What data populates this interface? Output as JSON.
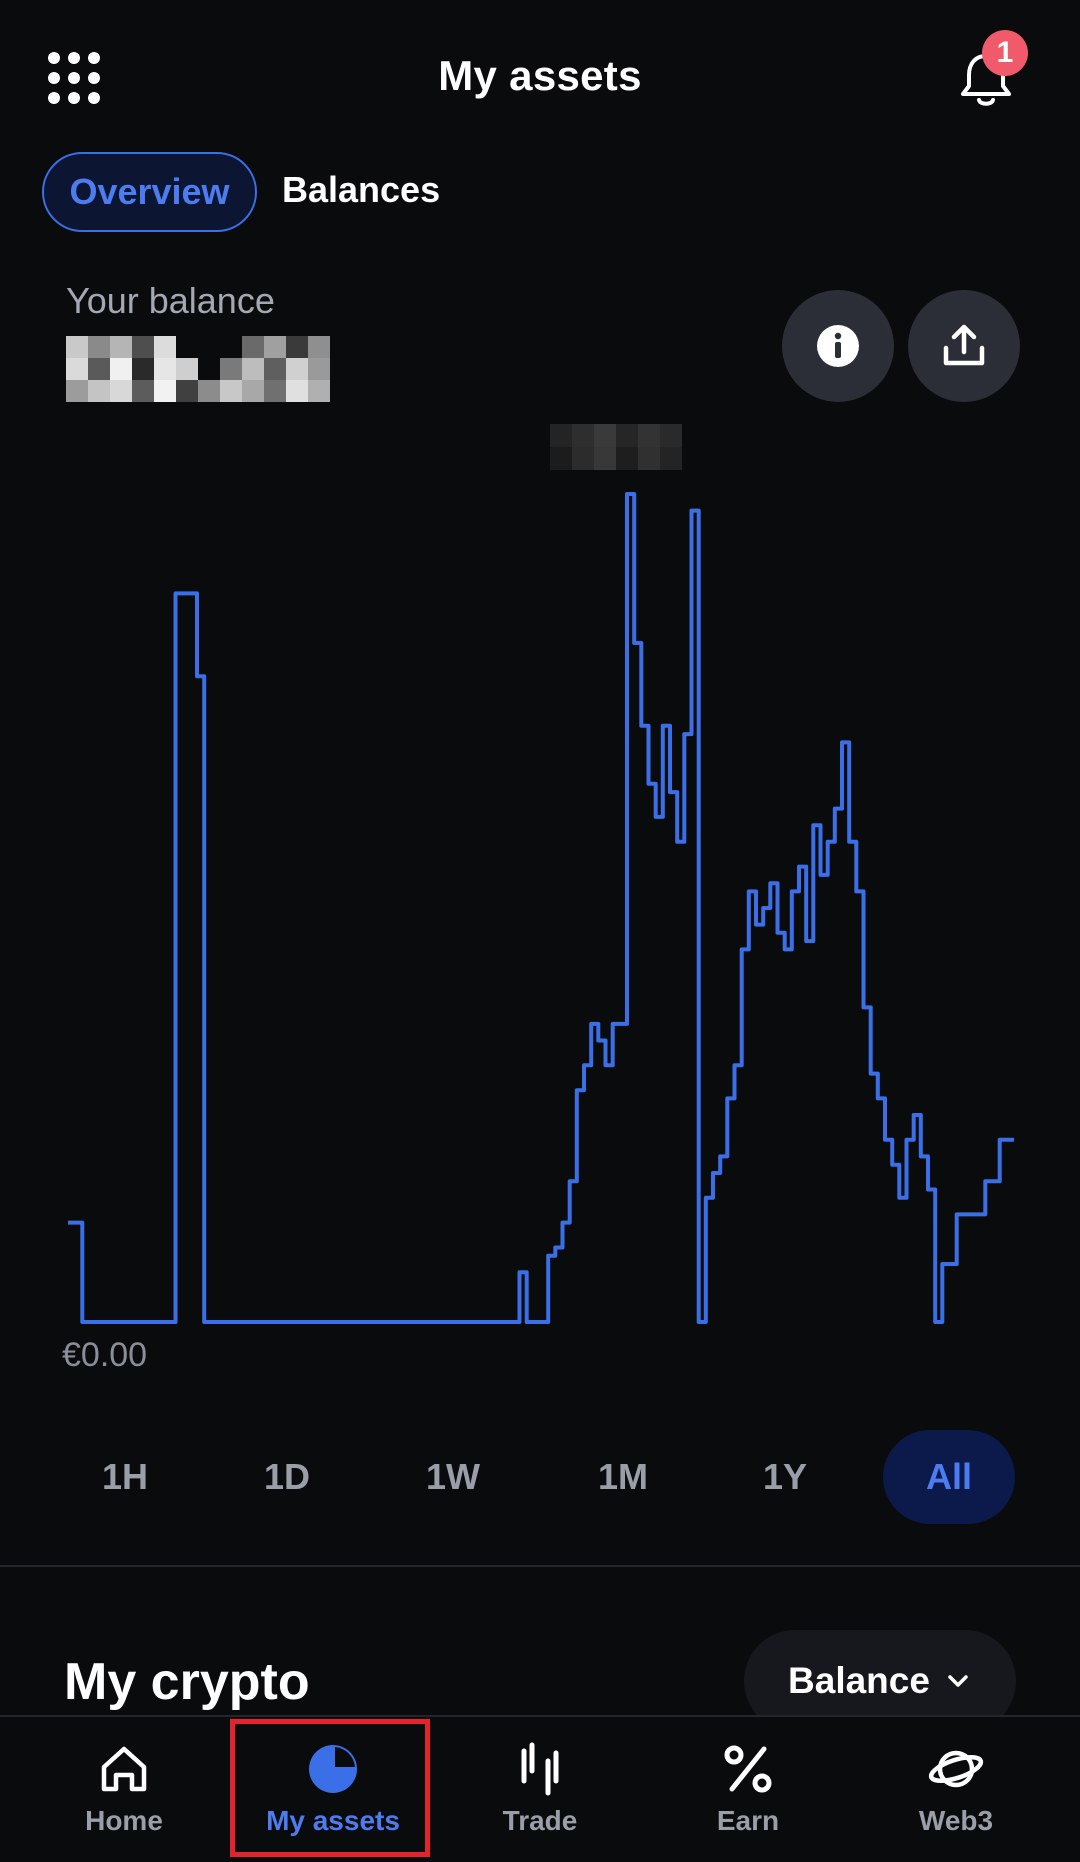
{
  "header": {
    "title": "My assets",
    "notification_count": "1",
    "menu_icon": "apps-grid-icon",
    "bell_icon": "bell-icon"
  },
  "tabs": [
    {
      "label": "Overview",
      "active": true
    },
    {
      "label": "Balances",
      "active": false
    }
  ],
  "balance": {
    "label": "Your balance",
    "value_obscured": true
  },
  "actions": {
    "info_icon": "info-icon",
    "share_icon": "share-icon"
  },
  "chart_data": {
    "type": "line",
    "series_color": "#3b6fe8",
    "baseline_label": "€0.00",
    "note_unlabeled_axes": true,
    "values": [
      0.12,
      0.12,
      0,
      0,
      0,
      0,
      0,
      0,
      0,
      0,
      0,
      0,
      0,
      0,
      0,
      0.88,
      0.88,
      0.88,
      0.78,
      0,
      0,
      0,
      0,
      0,
      0,
      0,
      0,
      0,
      0,
      0,
      0,
      0,
      0,
      0,
      0,
      0,
      0,
      0,
      0,
      0,
      0,
      0,
      0,
      0,
      0,
      0,
      0,
      0,
      0,
      0,
      0,
      0,
      0,
      0,
      0,
      0,
      0,
      0,
      0,
      0,
      0,
      0,
      0,
      0.06,
      0,
      0,
      0,
      0.08,
      0.09,
      0.12,
      0.17,
      0.28,
      0.31,
      0.36,
      0.34,
      0.31,
      0.36,
      0.36,
      1.0,
      0.82,
      0.72,
      0.65,
      0.61,
      0.72,
      0.64,
      0.58,
      0.71,
      0.98,
      0,
      0.15,
      0.18,
      0.2,
      0.27,
      0.31,
      0.45,
      0.52,
      0.48,
      0.5,
      0.53,
      0.47,
      0.45,
      0.52,
      0.55,
      0.46,
      0.6,
      0.54,
      0.58,
      0.62,
      0.7,
      0.58,
      0.52,
      0.38,
      0.3,
      0.27,
      0.22,
      0.19,
      0.15,
      0.22,
      0.25,
      0.2,
      0.16,
      0,
      0.07,
      0.07,
      0.13,
      0.13,
      0.13,
      0.13,
      0.17,
      0.17,
      0.22,
      0.22,
      0.22
    ],
    "ranges": [
      "1H",
      "1D",
      "1W",
      "1M",
      "1Y",
      "All"
    ],
    "selected_range": "All"
  },
  "section": {
    "title": "My crypto",
    "sort_label": "Balance"
  },
  "bottom_nav": [
    {
      "label": "Home",
      "icon": "home-icon",
      "active": false
    },
    {
      "label": "My assets",
      "icon": "pie-chart-icon",
      "active": true
    },
    {
      "label": "Trade",
      "icon": "candlestick-icon",
      "active": false
    },
    {
      "label": "Earn",
      "icon": "percent-icon",
      "active": false
    },
    {
      "label": "Web3",
      "icon": "planet-icon",
      "active": false
    }
  ]
}
